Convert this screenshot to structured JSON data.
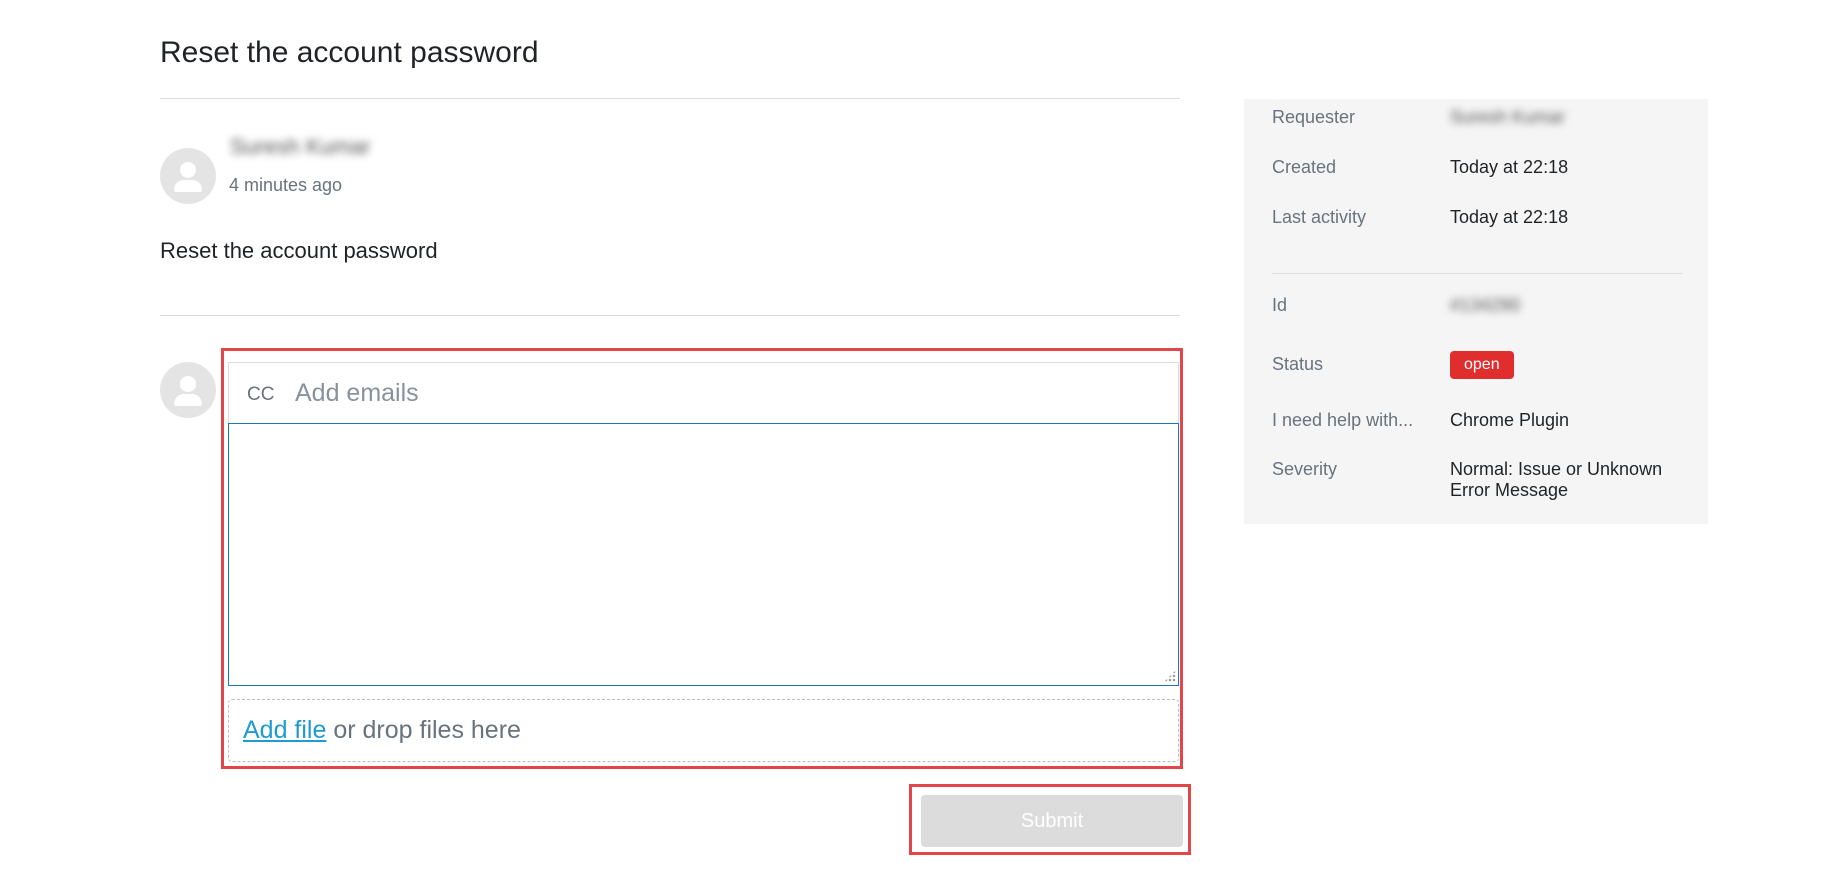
{
  "request": {
    "title": "Reset the account password"
  },
  "comment": {
    "author": "Suresh Kumar",
    "time": "4 minutes ago",
    "body": "Reset the account password"
  },
  "reply": {
    "cc_label": "CC",
    "cc_placeholder": "Add emails",
    "textarea_value": "",
    "add_file_label": "Add file",
    "drop_text": " or drop files here",
    "submit_label": "Submit"
  },
  "sidebar": {
    "requester_label": "Requester",
    "requester_value": "Suresh Kumar",
    "created_label": "Created",
    "created_value": "Today at 22:18",
    "last_activity_label": "Last activity",
    "last_activity_value": "Today at 22:18",
    "id_label": "Id",
    "id_value": "#134290",
    "status_label": "Status",
    "status_value": "open",
    "help_label": "I need help with...",
    "help_value": "Chrome Plugin",
    "severity_label": "Severity",
    "severity_value": "Normal: Issue or Unknown Error Message"
  },
  "colors": {
    "status_open": "#e02e2e",
    "link": "#1f9bd1",
    "highlight": "#e2454a",
    "focus_border": "#1f73b7"
  },
  "icons": {
    "avatar": "user-silhouette-icon"
  }
}
